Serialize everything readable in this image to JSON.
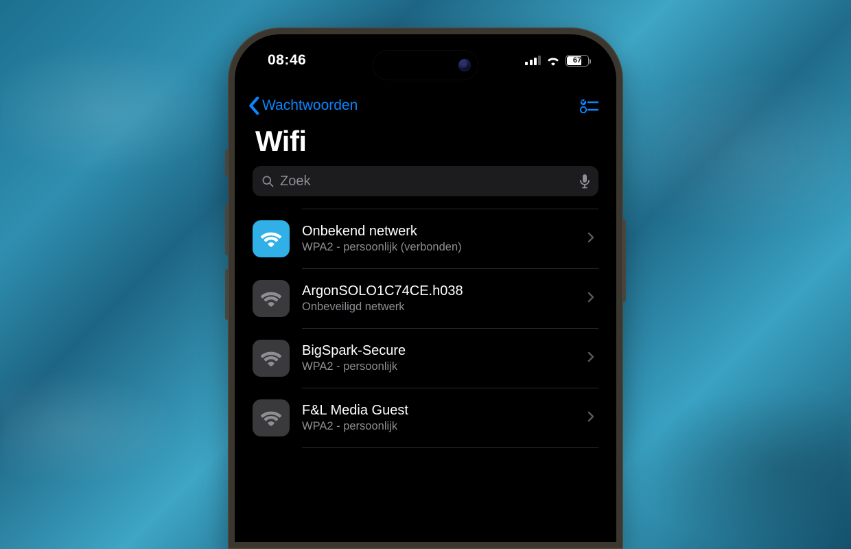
{
  "statusbar": {
    "time": "08:46",
    "battery_pct": "67"
  },
  "nav": {
    "back_label": "Wachtwoorden"
  },
  "page": {
    "title": "Wifi"
  },
  "search": {
    "placeholder": "Zoek"
  },
  "networks": [
    {
      "name": "Onbekend netwerk",
      "sub": "WPA2 - persoonlijk (verbonden)",
      "active": true
    },
    {
      "name": "ArgonSOLO1C74CE.h038",
      "sub": "Onbeveiligd netwerk",
      "active": false
    },
    {
      "name": "BigSpark-Secure",
      "sub": "WPA2 - persoonlijk",
      "active": false
    },
    {
      "name": "F&L Media Guest",
      "sub": "WPA2 - persoonlijk",
      "active": false
    }
  ],
  "colors": {
    "accent": "#0a84ff",
    "wifi_active": "#30b0e6"
  }
}
